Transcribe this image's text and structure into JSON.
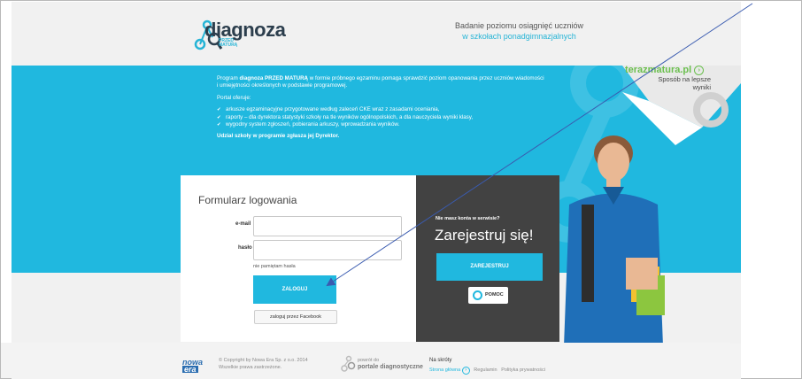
{
  "header": {
    "logo_text": "diagnoza",
    "logo_sub1": "PRZED",
    "logo_sub2": "MATURĄ",
    "tagline_line1": "Badanie poziomu osiągnięć uczniów",
    "tagline_line2": "w szkołach ponadgimnazjalnych"
  },
  "promo": {
    "title": "terazmatura.pl",
    "subtitle_line1": "Sposób na lepsze",
    "subtitle_line2": "wyniki"
  },
  "intro": {
    "p1_prefix": "Program ",
    "p1_bold": "diagnoza PRZED MATURĄ",
    "p1_rest": " w formie próbnego egzaminu pomaga sprawdzić poziom opanowania przez uczniów wiadomości",
    "p1_line2": "i umiejętności określonych w podstawie programowej.",
    "p2": "Portal oferuje:",
    "bullets": [
      "arkusze egzaminacyjne przygotowane według zaleceń CKE wraz z zasadami oceniania,",
      "raporty – dla dyrektora statystyki szkoły na tle wyników ogólnopolskich, a dla nauczyciela wyniki klasy,",
      "wygodny system zgłoszeń, pobierania arkuszy, wprowadzania wyników."
    ],
    "p3": "Udział szkoły w programie zgłasza jej Dyrektor."
  },
  "login": {
    "title": "Formularz logowania",
    "email_label": "e-mail",
    "email_value": "",
    "password_label": "hasło",
    "password_value": "",
    "forgot": "nie pamiętam hasła",
    "login_button": "ZALOGUJ",
    "facebook_button": "zaloguj przez Facebook"
  },
  "register": {
    "question": "Nie masz konta w serwisie?",
    "headline": "Zarejestruj się!",
    "register_button": "ZAREJESTRUJ",
    "help_button": "POMOC"
  },
  "footer": {
    "brand_line1": "nowa",
    "brand_line2": "era",
    "copyright_line1": "© Copyright by Nowa Era Sp. z o.o. 2014",
    "copyright_line2": "Wszelkie prawa zastrzeżone.",
    "portal_line1": "powrót do",
    "portal_line2": "portale diagnostyczne",
    "shortcuts": "Na skróty",
    "link_home": "Strona główna",
    "link_rules": "Regulamin",
    "link_privacy": "Polityka prywatności"
  },
  "colors": {
    "brand_blue": "#20b8df",
    "dark_panel": "#424242",
    "promo_green": "#6bbf4e",
    "annotation_arrow": "#3a5bb0"
  }
}
